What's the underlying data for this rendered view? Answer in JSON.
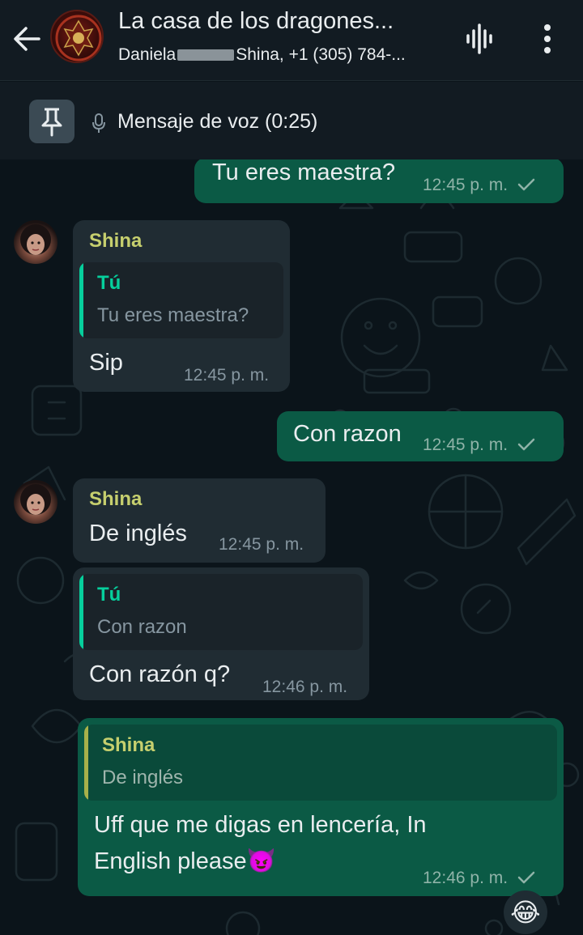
{
  "header": {
    "title": "La casa de los dragones...",
    "participants_start": "Daniela",
    "participants_end": "Shina, +1 (305) 784-..."
  },
  "pinned": {
    "text": "Mensaje de voz (0:25)"
  },
  "messages": [
    {
      "type": "outgoing",
      "text": "Tu eres maestra?",
      "time": "12:45 p. m."
    },
    {
      "type": "incoming",
      "sender": "Shina",
      "quote_name": "Tú",
      "quote_text": "Tu eres maestra?",
      "text": "Sip",
      "time": "12:45 p. m."
    },
    {
      "type": "outgoing",
      "text": "Con razon",
      "time": "12:45 p. m."
    },
    {
      "type": "incoming",
      "sender": "Shina",
      "text": "De inglés",
      "time": "12:45 p. m."
    },
    {
      "type": "incoming",
      "quote_name": "Tú",
      "quote_text": "Con razon",
      "text": "Con razón q?",
      "time": "12:46 p. m."
    },
    {
      "type": "outgoing",
      "quote_name": "Shina",
      "quote_text": "De inglés",
      "text_line1": "Uff que me digas en lencería, In",
      "text_line2": "English please",
      "emoji": "😈",
      "time": "12:46 p. m."
    }
  ],
  "reaction_emoji": "😂",
  "icons": {
    "back": "back-arrow-icon",
    "voice_call": "audio-wave-icon",
    "menu": "more-vertical-icon",
    "pin": "pin-icon",
    "mic": "mic-icon",
    "tick": "single-check-icon"
  },
  "colors": {
    "header_bg": "#121b22",
    "chat_bg": "#0b141a",
    "incoming_bubble": "#202c33",
    "outgoing_bubble": "#0b5a45",
    "sender_name": "#c6cf6e",
    "quote_bar_green": "#06cf9c",
    "quote_bar_yellow": "#a8b14a"
  }
}
